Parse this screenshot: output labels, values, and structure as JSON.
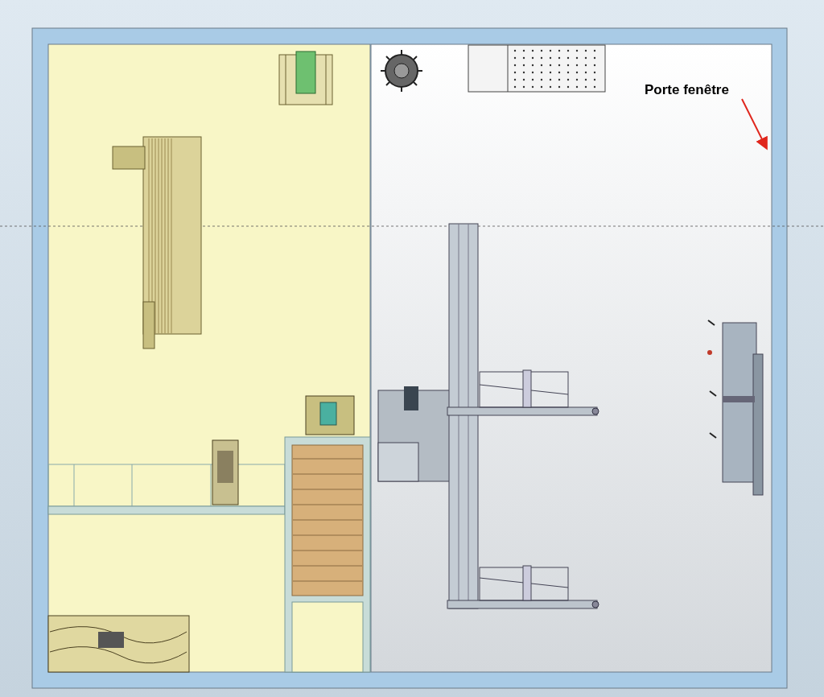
{
  "annotation": {
    "label": "Porte fenêtre"
  }
}
